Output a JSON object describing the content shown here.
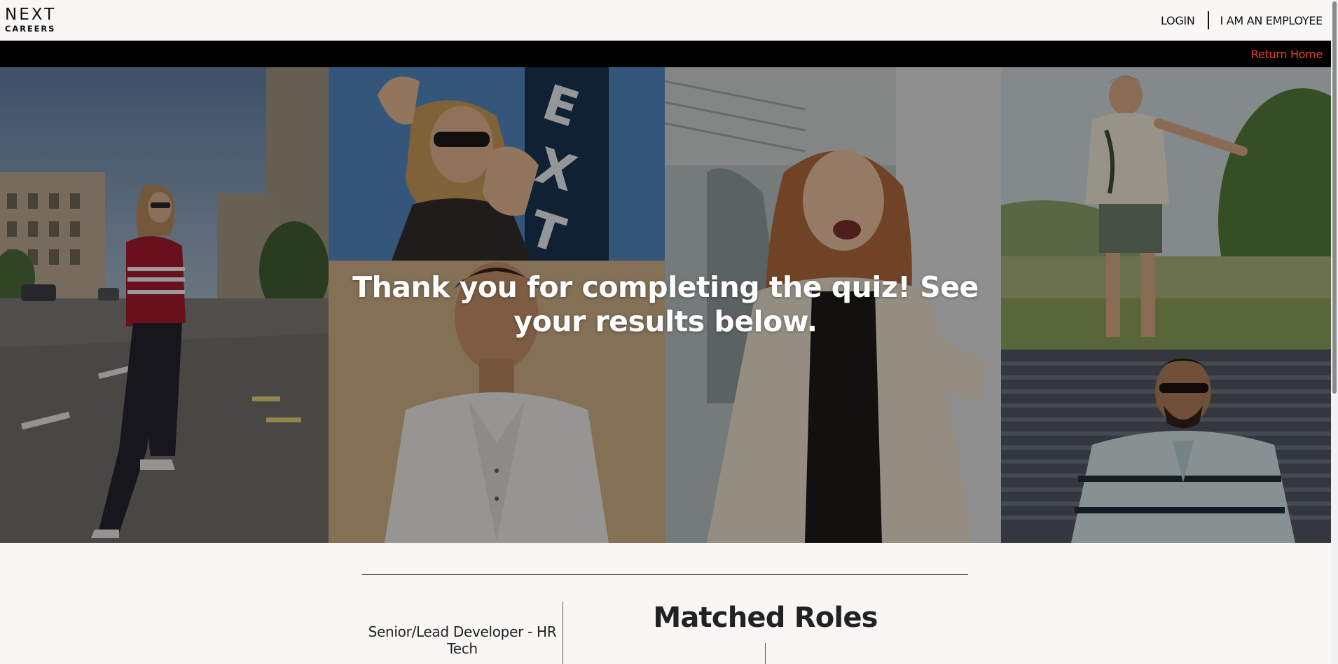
{
  "header": {
    "logo_top": "NEXT",
    "logo_bottom": "CAREERS",
    "login_label": "LOGIN",
    "employee_label": "I AM AN EMPLOYEE"
  },
  "topbar": {
    "return_home_label": "Return Home",
    "accent_color": "#e8402a"
  },
  "hero": {
    "title": "Thank you for completing the quiz! See your results below.",
    "tiles": [
      {
        "name": "hero-photo-woman-street",
        "subject": "woman in striped top walking on city street"
      },
      {
        "name": "hero-photo-woman-sunglasses",
        "subject": "woman in sunglasses framing hands by NEXT sign"
      },
      {
        "name": "hero-photo-man-white-shirt",
        "subject": "young man in white shirt against wall"
      },
      {
        "name": "hero-photo-woman-laughing",
        "subject": "laughing woman in beige coat on stairs"
      },
      {
        "name": "hero-photo-man-field",
        "subject": "man in printed shirt and shorts in green field"
      },
      {
        "name": "hero-photo-man-polo",
        "subject": "man in sunglasses and striped polo"
      }
    ]
  },
  "results": {
    "role_title": "Senior/Lead Developer - HR Tech",
    "matched_heading": "Matched Roles"
  }
}
